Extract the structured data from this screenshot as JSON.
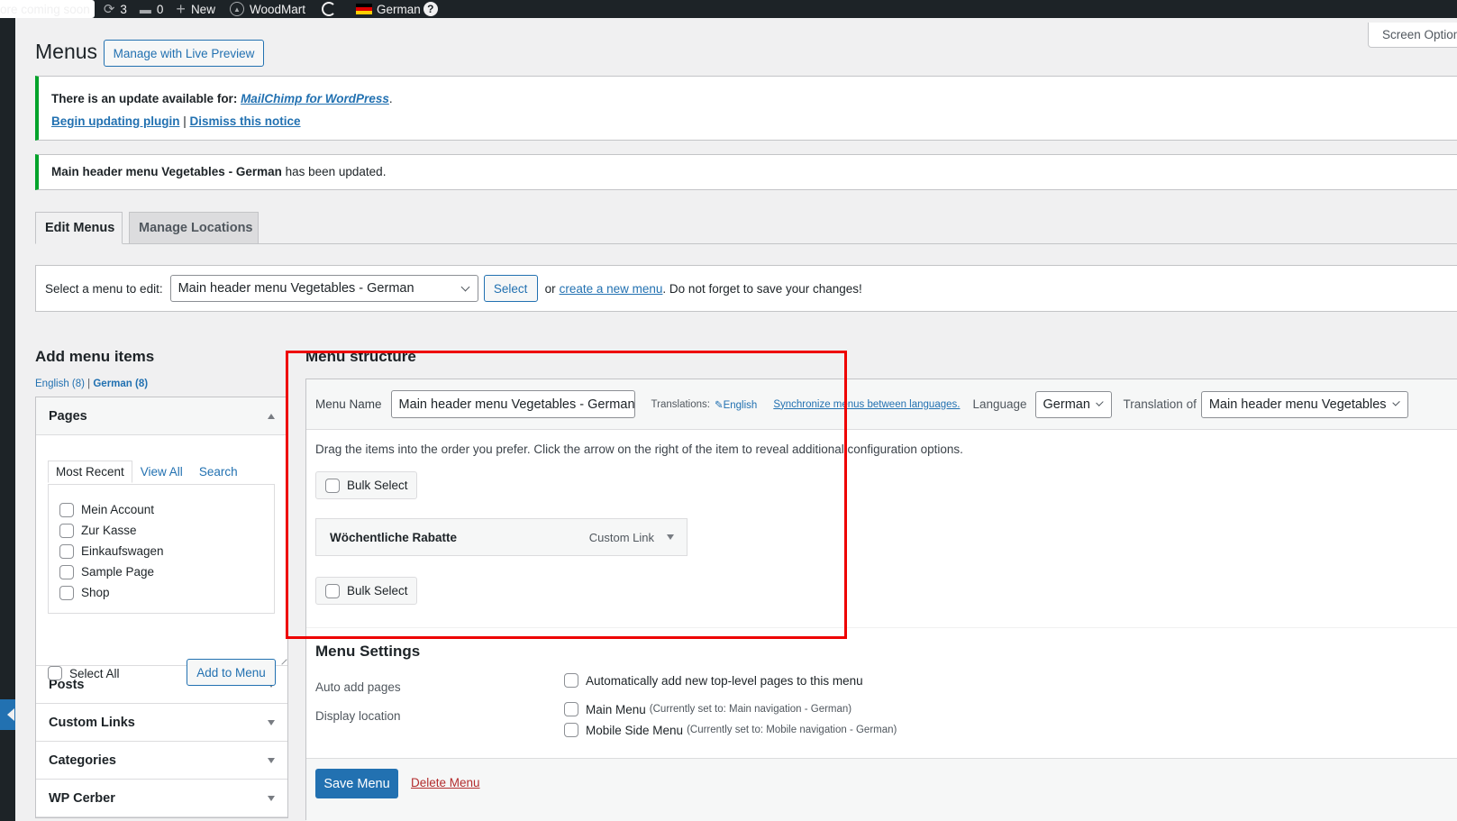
{
  "admin_bar": {
    "coming_soon": "ore coming soon",
    "updates_count": "3",
    "comments_count": "0",
    "new_label": "New",
    "theme_label": "WoodMart",
    "language_label": "German",
    "help_label": "?"
  },
  "screen_options_label": "Screen Options",
  "page": {
    "title": "Menus",
    "live_preview_button": "Manage with Live Preview"
  },
  "notices": {
    "update": {
      "prefix": "There is an update available for: ",
      "plugin_link": "MailChimp for WordPress",
      "suffix": ".",
      "begin_link": "Begin updating plugin",
      "separator": " | ",
      "dismiss_link": "Dismiss this notice"
    },
    "updated": {
      "menu_name": "Main header menu Vegetables - German",
      "suffix": " has been updated."
    }
  },
  "tabs": [
    {
      "label": "Edit Menus",
      "active": true
    },
    {
      "label": "Manage Locations",
      "active": false
    }
  ],
  "manage_menus": {
    "label": "Select a menu to edit:",
    "selected_menu": "Main header menu Vegetables - German",
    "select_button": "Select",
    "or_text": "or ",
    "create_link": "create a new menu",
    "reminder": ". Do not forget to save your changes!"
  },
  "add_menu_items": {
    "title": "Add menu items",
    "lang_english": "English (8)",
    "lang_separator": " | ",
    "lang_german": "German (8)",
    "pages": {
      "title": "Pages",
      "tabs": [
        "Most Recent",
        "View All",
        "Search"
      ],
      "items": [
        {
          "label": "Mein Account",
          "checked": false
        },
        {
          "label": "Zur Kasse",
          "checked": false
        },
        {
          "label": "Einkaufswagen",
          "checked": false
        },
        {
          "label": "Sample Page",
          "checked": false
        },
        {
          "label": "Shop",
          "checked": false
        }
      ],
      "select_all": "Select All",
      "add_button": "Add to Menu"
    },
    "sections": [
      "Posts",
      "Custom Links",
      "Categories",
      "WP Cerber"
    ]
  },
  "menu_structure": {
    "title": "Menu structure",
    "menu_name_label": "Menu Name",
    "menu_name_value": "Main header menu Vegetables - German",
    "translations_label": "Translations:",
    "translation_link": "English",
    "sync_link": "Synchronize menus between languages.",
    "language_label": "Language",
    "language_value": "German",
    "translation_of_label": "Translation of",
    "translation_of_value": "Main header menu Vegetables",
    "instructions": "Drag the items into the order you prefer. Click the arrow on the right of the item to reveal additional configuration options.",
    "bulk_select": "Bulk Select",
    "items": [
      {
        "title": "Wöchentliche Rabatte",
        "type": "Custom Link"
      }
    ]
  },
  "menu_settings": {
    "title": "Menu Settings",
    "auto_add_label": "Auto add pages",
    "auto_add_option": "Automatically add new top-level pages to this menu",
    "display_location_label": "Display location",
    "locations": [
      {
        "label": "Main Menu",
        "note": "(Currently set to: Main navigation - German)",
        "checked": false
      },
      {
        "label": "Mobile Side Menu",
        "note": "(Currently set to: Mobile navigation - German)",
        "checked": false
      }
    ]
  },
  "footer": {
    "save_button": "Save Menu",
    "delete_link": "Delete Menu"
  },
  "colors": {
    "accent": "#2271b1",
    "notice_success": "#00a32a",
    "delete": "#b32d2e",
    "highlight": "#ee0000"
  }
}
